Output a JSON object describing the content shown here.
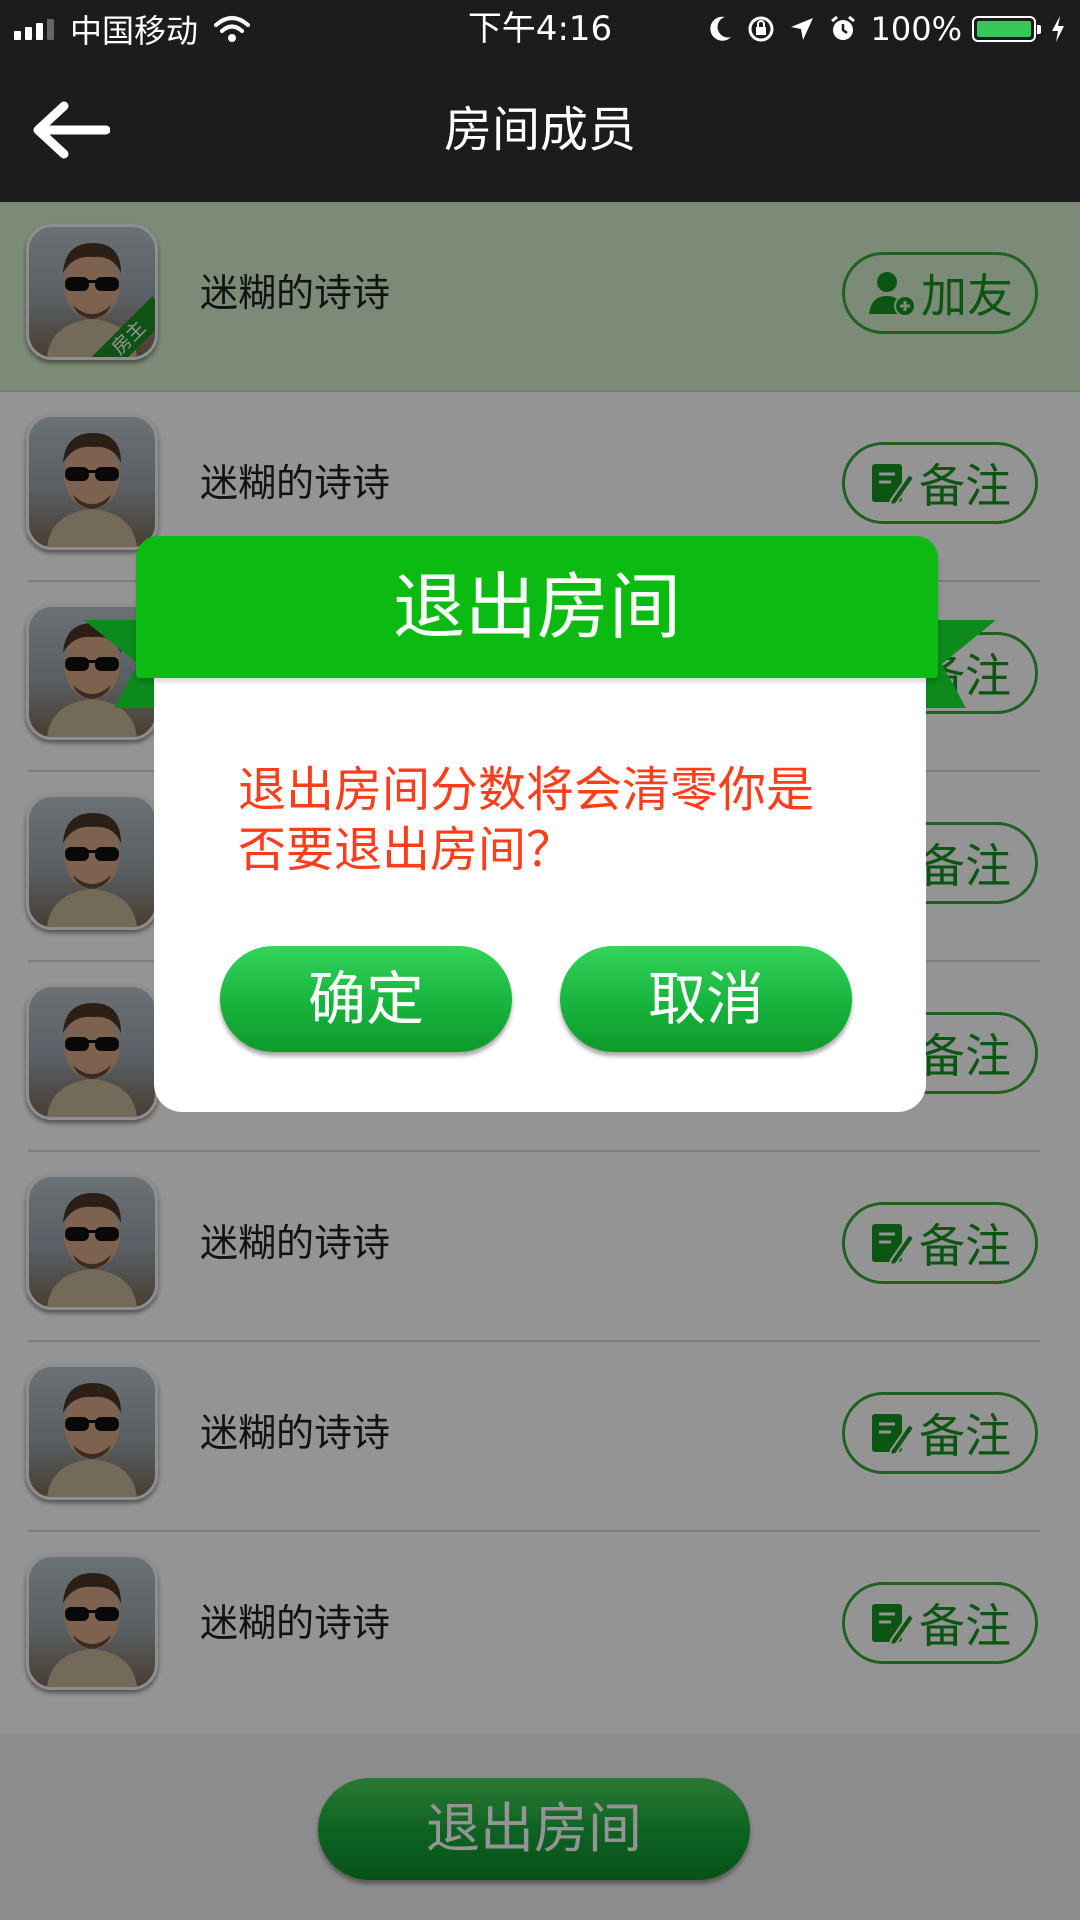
{
  "status_bar": {
    "carrier": "中国移动",
    "time": "下午4:16",
    "battery": "100%",
    "battery_level": 1.0,
    "icons": [
      "signal-icon",
      "wifi-icon",
      "moon-icon",
      "rotation-lock-icon",
      "location-icon",
      "alarm-icon",
      "battery-icon",
      "charging-icon"
    ]
  },
  "nav": {
    "title": "房间成员",
    "back_icon": "back-arrow-icon"
  },
  "members": [
    {
      "name": "迷糊的诗诗",
      "badge": "房主",
      "action": "加友",
      "action_icon": "add-friend-icon"
    },
    {
      "name": "迷糊的诗诗",
      "action": "备注",
      "action_icon": "edit-note-icon"
    },
    {
      "name": "",
      "action": "备注",
      "action_icon": "edit-note-icon"
    },
    {
      "name": "",
      "action": "备注",
      "action_icon": "edit-note-icon"
    },
    {
      "name": "",
      "action": "备注",
      "action_icon": "edit-note-icon"
    },
    {
      "name": "迷糊的诗诗",
      "action": "备注",
      "action_icon": "edit-note-icon"
    },
    {
      "name": "迷糊的诗诗",
      "action": "备注",
      "action_icon": "edit-note-icon"
    },
    {
      "name": "迷糊的诗诗",
      "action": "备注",
      "action_icon": "edit-note-icon"
    }
  ],
  "bottom": {
    "leave_label": "退出房间"
  },
  "dialog": {
    "title": "退出房间",
    "message": "退出房间分数将会清零你是否要退出房间？",
    "confirm_label": "确定",
    "cancel_label": "取消"
  },
  "colors": {
    "accent_green": "#0bbb12",
    "warning_red": "#ff3d1a",
    "host_row_bg": "#d6f0cf",
    "bar_dark": "#1c1c1e"
  }
}
